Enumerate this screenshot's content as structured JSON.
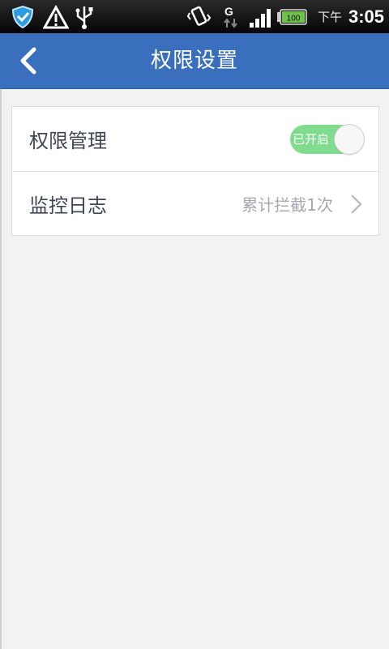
{
  "status_bar": {
    "icons": [
      "shield-icon",
      "warning-icon",
      "usb-icon",
      "vibrate-icon",
      "network-g-icon",
      "signal-icon",
      "battery-icon"
    ],
    "battery_level": "100",
    "network_type": "G",
    "ampm": "下午",
    "time": "3:05"
  },
  "header": {
    "title": "权限设置",
    "background_color": "#3a6fbe"
  },
  "settings": {
    "permission_management": {
      "label": "权限管理",
      "toggle_text": "已开启",
      "toggle_on": true,
      "toggle_color": "#7fdc8f"
    },
    "monitor_log": {
      "label": "监控日志",
      "value": "累计拦截1次"
    }
  }
}
